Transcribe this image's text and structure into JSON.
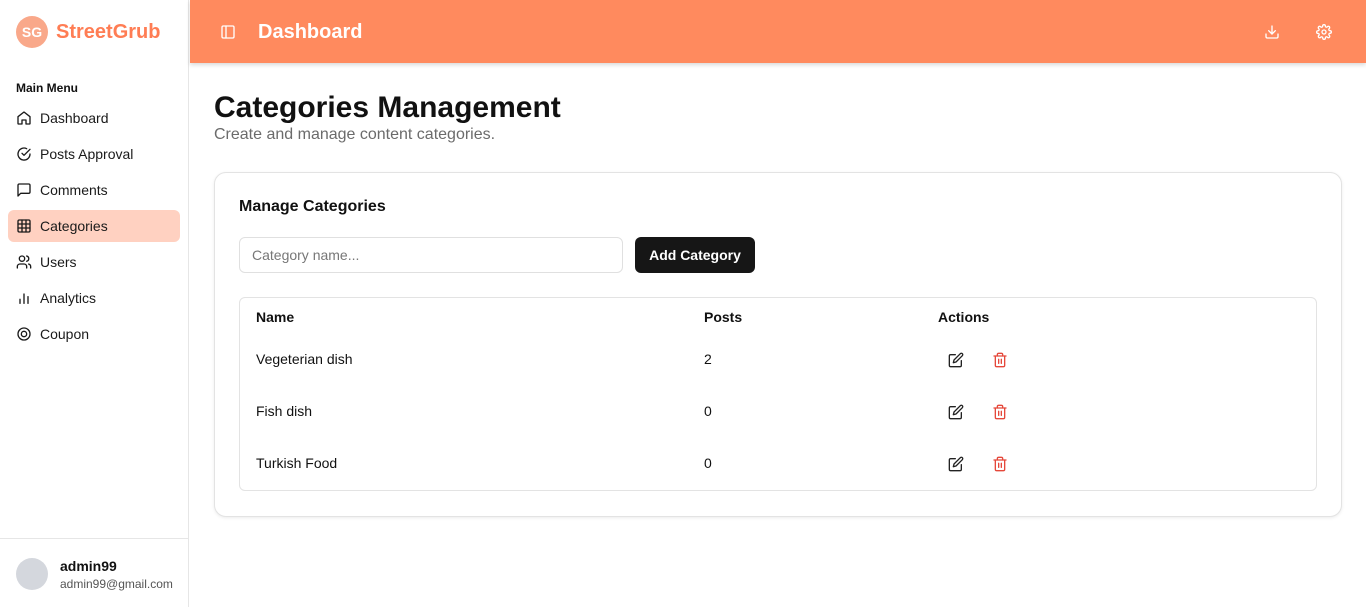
{
  "brand": {
    "logo_text": "SG",
    "name": "StreetGrub",
    "accent": "#ff8a5e"
  },
  "sidebar": {
    "menu_title": "Main Menu",
    "items": [
      {
        "label": "Dashboard",
        "icon": "home-icon",
        "active": false
      },
      {
        "label": "Posts Approval",
        "icon": "check-circle-icon",
        "active": false
      },
      {
        "label": "Comments",
        "icon": "message-square-icon",
        "active": false
      },
      {
        "label": "Categories",
        "icon": "grid-icon",
        "active": true
      },
      {
        "label": "Users",
        "icon": "users-icon",
        "active": false
      },
      {
        "label": "Analytics",
        "icon": "bar-chart-icon",
        "active": false
      },
      {
        "label": "Coupon",
        "icon": "target-icon",
        "active": false
      }
    ],
    "user": {
      "name": "admin99",
      "email": "admin99@gmail.com"
    }
  },
  "topbar": {
    "title": "Dashboard",
    "icons": [
      "sidebar-toggle-icon",
      "download-icon",
      "settings-icon"
    ]
  },
  "page": {
    "title": "Categories Management",
    "subtitle": "Create and manage content categories."
  },
  "card": {
    "title": "Manage Categories",
    "input_placeholder": "Category name...",
    "input_value": "",
    "add_button": "Add Category",
    "columns": [
      "Name",
      "Posts",
      "Actions"
    ],
    "rows": [
      {
        "name": "Vegeterian dish",
        "posts": "2"
      },
      {
        "name": "Fish dish",
        "posts": "0"
      },
      {
        "name": "Turkish Food",
        "posts": "0"
      }
    ]
  },
  "colors": {
    "delete": "#e5483b",
    "active_bg": "#ffd1c1",
    "button_dark": "#161616"
  }
}
